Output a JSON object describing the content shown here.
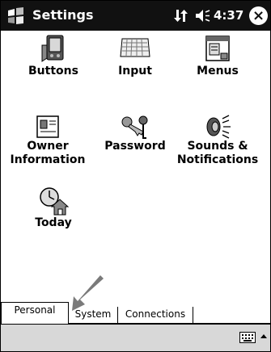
{
  "titlebar": {
    "title": "Settings",
    "time": "4:37",
    "close_symbol": "×",
    "start_icon": "windows-start-icon",
    "connectivity_icon": "connectivity-icon",
    "volume_icon": "volume-icon"
  },
  "items": [
    {
      "label": "Buttons",
      "icon": "buttons-icon"
    },
    {
      "label": "Input",
      "icon": "keyboard-icon"
    },
    {
      "label": "Menus",
      "icon": "menus-icon"
    },
    {
      "label": "Owner Information",
      "icon": "owner-information-icon"
    },
    {
      "label": "Password",
      "icon": "password-keys-icon"
    },
    {
      "label": "Sounds & Notifications",
      "icon": "speaker-icon"
    },
    {
      "label": "Today",
      "icon": "today-icon"
    }
  ],
  "tabs": [
    {
      "label": "Personal",
      "active": true
    },
    {
      "label": "System",
      "active": false
    },
    {
      "label": "Connections",
      "active": false
    }
  ],
  "bottom": {
    "keyboard_icon": "keyboard-small-icon",
    "up_icon": "up-arrow-icon"
  },
  "overlay": {
    "arrow_icon": "gray-pointer-arrow-icon",
    "arrow_color": "#7a7a7a"
  }
}
